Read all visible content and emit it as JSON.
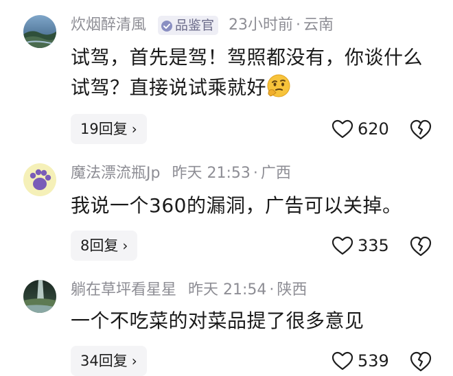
{
  "comments": [
    {
      "username": "炊烟醉清風",
      "badge": "品鉴官",
      "time": "23小时前",
      "location": "云南",
      "text": "试驾，首先是驾！驾照都没有，你谈什么试驾？直接说试乘就好",
      "emoji": "thinking-face-emoji",
      "replies": "19回复",
      "likes": "620"
    },
    {
      "username": "魔法漂流瓶Jp",
      "time": "昨天 21:53",
      "location": "广西",
      "text": "我说一个360的漏洞，广告可以关掉。",
      "replies": "8回复",
      "likes": "335"
    },
    {
      "username": "躺在草坪看星星",
      "time": "昨天 21:54",
      "location": "陕西",
      "text": "一个不吃菜的对菜品提了很多意见",
      "replies": "34回复",
      "likes": "539"
    }
  ],
  "icons": {
    "badge": "verified-check-icon",
    "like": "heart-outline-icon",
    "dislike": "broken-heart-icon",
    "expand": "chevron-right-icon"
  },
  "colors": {
    "meta_text": "#8d8d94",
    "body_text": "#1a1a1a",
    "reply_bg": "#f4f4f6",
    "badge_bg": "#eeeef5"
  }
}
